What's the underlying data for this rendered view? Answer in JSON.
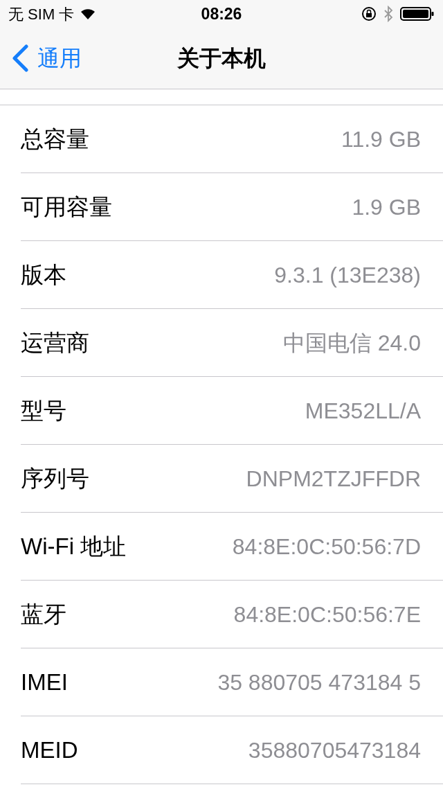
{
  "status_bar": {
    "carrier": "无 SIM 卡",
    "time": "08:26"
  },
  "nav_bar": {
    "back": "通用",
    "title": "关于本机"
  },
  "rows": [
    {
      "label": "总容量",
      "value": "11.9 GB"
    },
    {
      "label": "可用容量",
      "value": "1.9 GB"
    },
    {
      "label": "版本",
      "value": "9.3.1 (13E238)"
    },
    {
      "label": "运营商",
      "value": "中国电信 24.0"
    },
    {
      "label": "型号",
      "value": "ME352LL/A"
    },
    {
      "label": "序列号",
      "value": "DNPM2TZJFFDR"
    },
    {
      "label": "Wi-Fi 地址",
      "value": "84:8E:0C:50:56:7D"
    },
    {
      "label": "蓝牙",
      "value": "84:8E:0C:50:56:7E"
    },
    {
      "label": "IMEI",
      "value": "35 880705 473184 5"
    },
    {
      "label": "MEID",
      "value": "35880705473184"
    }
  ]
}
